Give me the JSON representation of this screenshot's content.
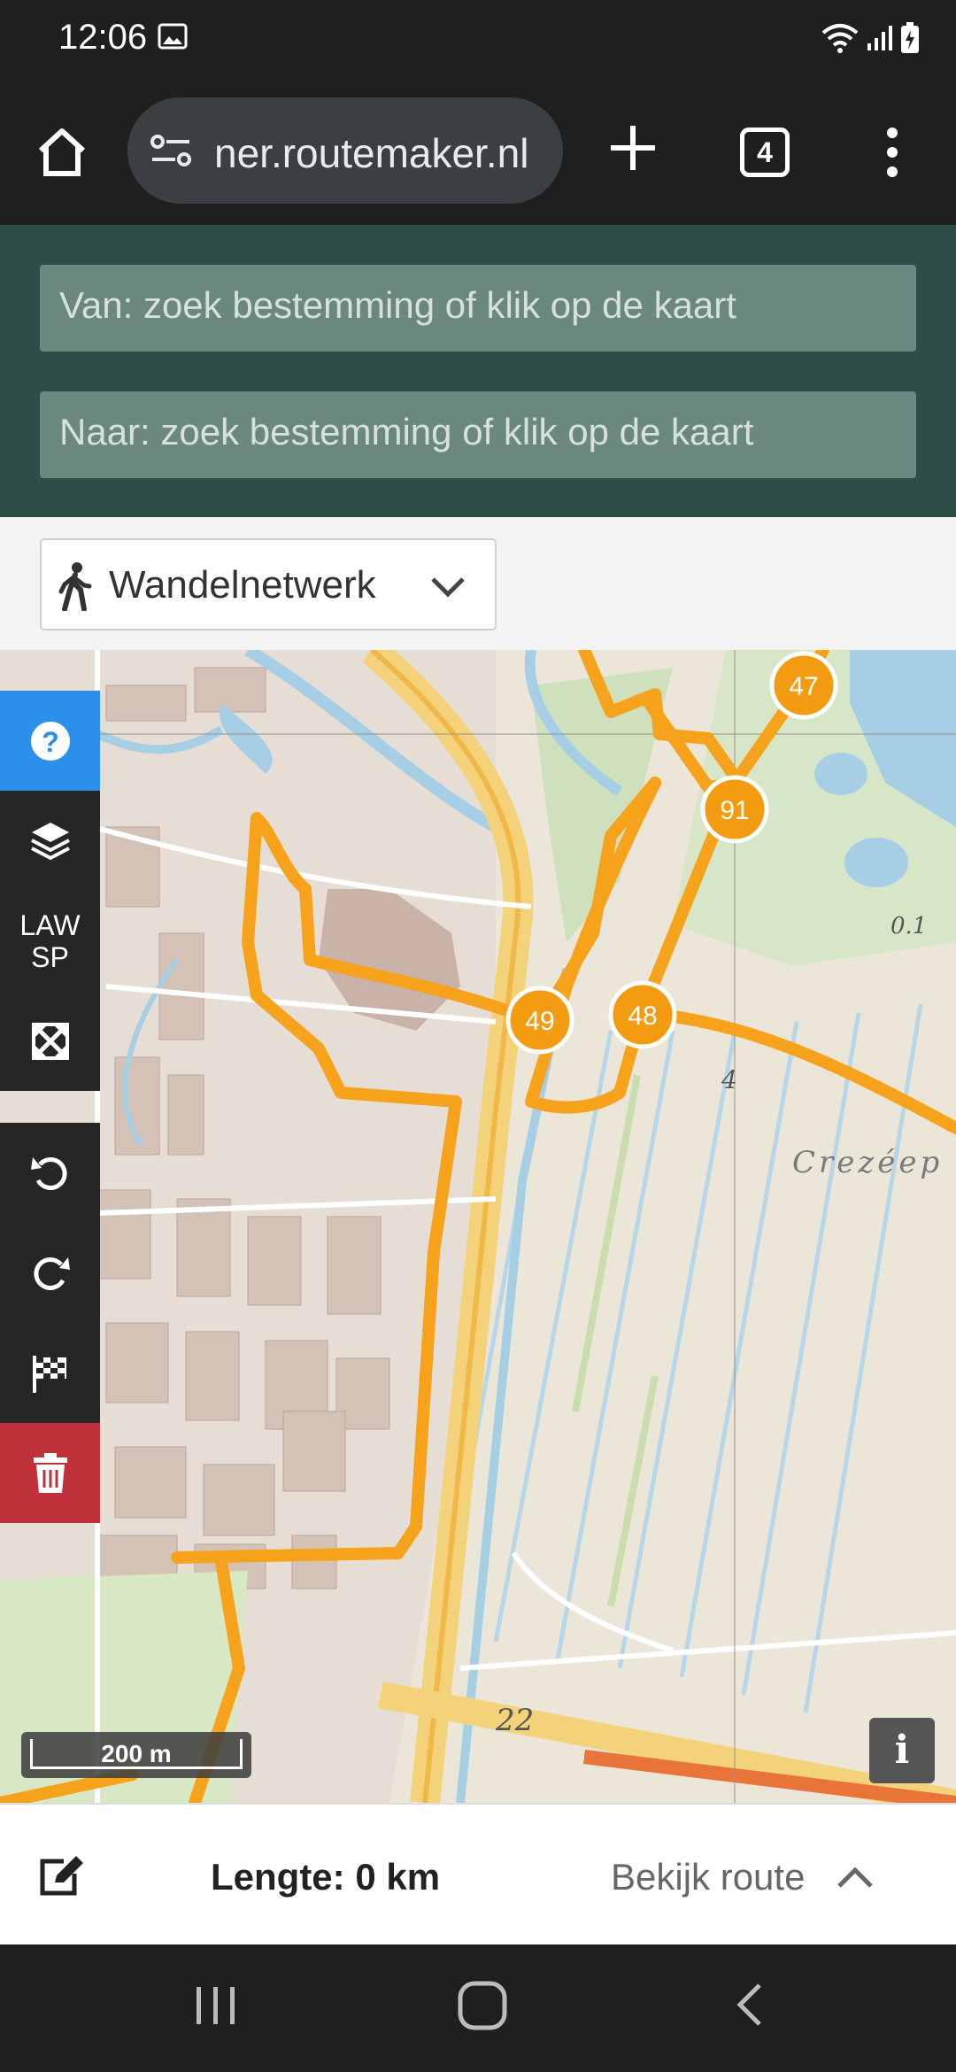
{
  "status_bar": {
    "time": "12:06"
  },
  "browser": {
    "url": "ner.routemaker.nl",
    "tab_count": "4"
  },
  "search": {
    "from_placeholder": "Van: zoek bestemming of klik op de kaart",
    "to_placeholder": "Naar: zoek bestemming of klik op de kaart"
  },
  "profile": {
    "selected": "Wandelnetwerk"
  },
  "map": {
    "nodes": [
      "47",
      "91",
      "49",
      "48"
    ],
    "labels": {
      "place": "Crezéep",
      "height": "0.1",
      "km": "4",
      "road": "22"
    },
    "scale": "200 m",
    "info": "i",
    "law_label_1": "LAW",
    "law_label_2": "SP",
    "route_color": "#f7a21b",
    "node_color": "#f39c12"
  },
  "bottom": {
    "length": "Lengte: 0 km",
    "view_route": "Bekijk route"
  },
  "colors": {
    "header_green": "#2c4e47",
    "help_blue": "#2b90e9",
    "trash_red": "#c0313b"
  }
}
